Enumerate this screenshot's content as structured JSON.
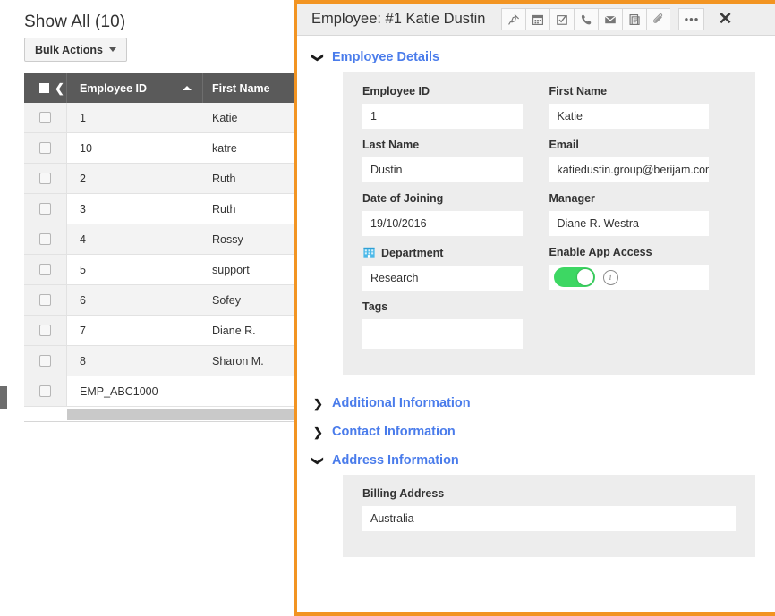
{
  "list": {
    "show_all_label": "Show All (10)",
    "bulk_actions_label": "Bulk Actions",
    "columns": [
      "Employee ID",
      "First Name"
    ],
    "sort_column": "Employee ID",
    "sort_direction": "asc",
    "rows": [
      {
        "employee_id": "1",
        "first_name": "Katie"
      },
      {
        "employee_id": "10",
        "first_name": "katre"
      },
      {
        "employee_id": "2",
        "first_name": "Ruth"
      },
      {
        "employee_id": "3",
        "first_name": "Ruth"
      },
      {
        "employee_id": "4",
        "first_name": "Rossy"
      },
      {
        "employee_id": "5",
        "first_name": "support"
      },
      {
        "employee_id": "6",
        "first_name": "Sofey"
      },
      {
        "employee_id": "7",
        "first_name": "Diane R."
      },
      {
        "employee_id": "8",
        "first_name": "Sharon M."
      },
      {
        "employee_id": "EMP_ABC1000",
        "first_name": ""
      }
    ]
  },
  "panel": {
    "title": "Employee: #1 Katie Dustin",
    "accent_color": "#f29422",
    "toolbar": [
      {
        "name": "pin-icon",
        "tooltip": "Pin"
      },
      {
        "name": "calendar-icon",
        "tooltip": "Calendar"
      },
      {
        "name": "task-icon",
        "tooltip": "Task"
      },
      {
        "name": "phone-icon",
        "tooltip": "Call"
      },
      {
        "name": "email-icon",
        "tooltip": "Email"
      },
      {
        "name": "note-icon",
        "tooltip": "Note"
      },
      {
        "name": "attachment-icon",
        "tooltip": "Attachment"
      }
    ],
    "more_label": "•••",
    "close_label": "✕",
    "sections": {
      "employee_details": {
        "title": "Employee Details",
        "expanded": true,
        "chevron": "⌄",
        "fields": {
          "employee_id": {
            "label": "Employee ID",
            "value": "1"
          },
          "first_name": {
            "label": "First Name",
            "value": "Katie"
          },
          "last_name": {
            "label": "Last Name",
            "value": "Dustin"
          },
          "email": {
            "label": "Email",
            "value": "katiedustin.group@berijam.com"
          },
          "date_of_joining": {
            "label": "Date of Joining",
            "value": "19/10/2016"
          },
          "manager": {
            "label": "Manager",
            "value": "Diane R. Westra"
          },
          "department": {
            "label": "Department",
            "value": "Research",
            "icon": "building-icon"
          },
          "enable_app_access": {
            "label": "Enable App Access",
            "value": "on",
            "info": "i"
          },
          "tags": {
            "label": "Tags",
            "value": ""
          }
        }
      },
      "additional_information": {
        "title": "Additional Information",
        "expanded": false,
        "chevron": "›"
      },
      "contact_information": {
        "title": "Contact Information",
        "expanded": false,
        "chevron": "›"
      },
      "address_information": {
        "title": "Address Information",
        "expanded": true,
        "chevron": "⌄",
        "fields": {
          "billing_address": {
            "label": "Billing Address",
            "value": "Australia"
          }
        }
      }
    }
  }
}
